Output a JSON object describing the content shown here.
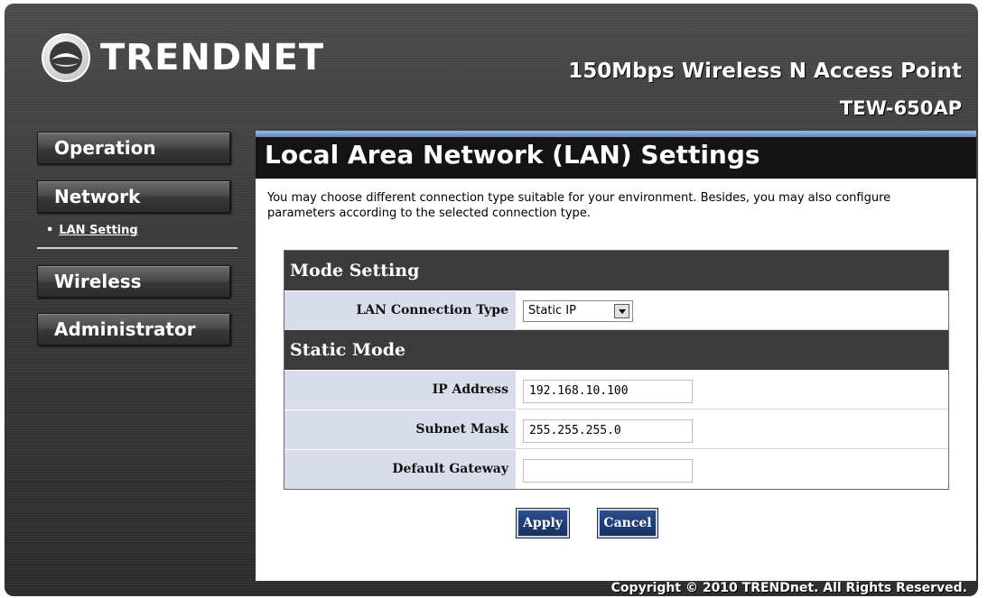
{
  "brand": {
    "logo_text": "TRENDNET",
    "product_title": "150Mbps Wireless N Access Point",
    "model": "TEW-650AP"
  },
  "sidebar": {
    "items": [
      {
        "label": "Operation"
      },
      {
        "label": "Network"
      },
      {
        "label": "Wireless"
      },
      {
        "label": "Administrator"
      }
    ],
    "sub_items": [
      {
        "label": "LAN Setting",
        "active": true
      }
    ]
  },
  "content": {
    "title": "Local Area Network (LAN) Settings",
    "description": "You may choose different connection type suitable for your environment. Besides, you may also configure parameters according to the selected connection type.",
    "mode_section": {
      "title": "Mode Setting",
      "connection_type_label": "LAN Connection Type",
      "connection_type_value": "Static IP"
    },
    "static_section": {
      "title": "Static Mode",
      "ip_label": "IP Address",
      "ip_value": "192.168.10.100",
      "subnet_label": "Subnet Mask",
      "subnet_value": "255.255.255.0",
      "gateway_label": "Default Gateway",
      "gateway_value": ""
    },
    "buttons": {
      "apply": "Apply",
      "cancel": "Cancel"
    }
  },
  "footer": {
    "copyright": "Copyright © 2010 TRENDnet. All Rights Reserved."
  },
  "colors": {
    "accent_blue": "#5a86c4",
    "button_blue": "#1f3d75",
    "section_header": "#3b3b3b",
    "label_bg": "#d9dcea"
  }
}
